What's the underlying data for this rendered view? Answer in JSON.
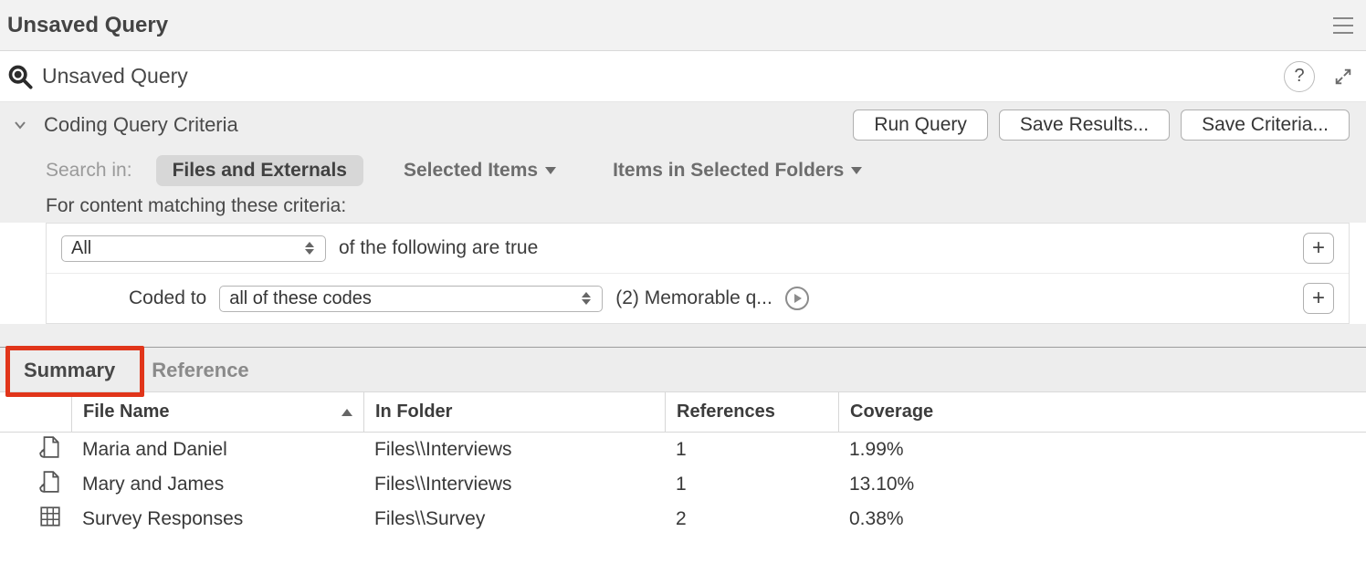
{
  "titlebar": {
    "title": "Unsaved Query"
  },
  "subheader": {
    "title": "Unsaved Query",
    "help": "?"
  },
  "criteria": {
    "title": "Coding Query Criteria",
    "buttons": {
      "run": "Run Query",
      "save_results": "Save Results...",
      "save_criteria": "Save Criteria..."
    },
    "search_label": "Search in:",
    "option_files": "Files and Externals",
    "option_selected": "Selected Items",
    "option_folders": "Items in Selected Folders",
    "content_label": "For content matching these criteria:",
    "row1": {
      "select": "All",
      "suffix": "of the following are true"
    },
    "row2": {
      "label": "Coded to",
      "select": "all of these codes",
      "summary": "(2) Memorable q..."
    }
  },
  "tabs": {
    "summary": "Summary",
    "reference": "Reference"
  },
  "table": {
    "headers": {
      "name": "File Name",
      "folder": "In Folder",
      "refs": "References",
      "cov": "Coverage"
    },
    "rows": [
      {
        "icon": "doc",
        "name": "Maria and Daniel",
        "folder": "Files\\\\Interviews",
        "refs": "1",
        "cov": "1.99%"
      },
      {
        "icon": "doc",
        "name": "Mary and James",
        "folder": "Files\\\\Interviews",
        "refs": "1",
        "cov": "13.10%"
      },
      {
        "icon": "grid",
        "name": "Survey Responses",
        "folder": "Files\\\\Survey",
        "refs": "2",
        "cov": "0.38%"
      }
    ]
  }
}
